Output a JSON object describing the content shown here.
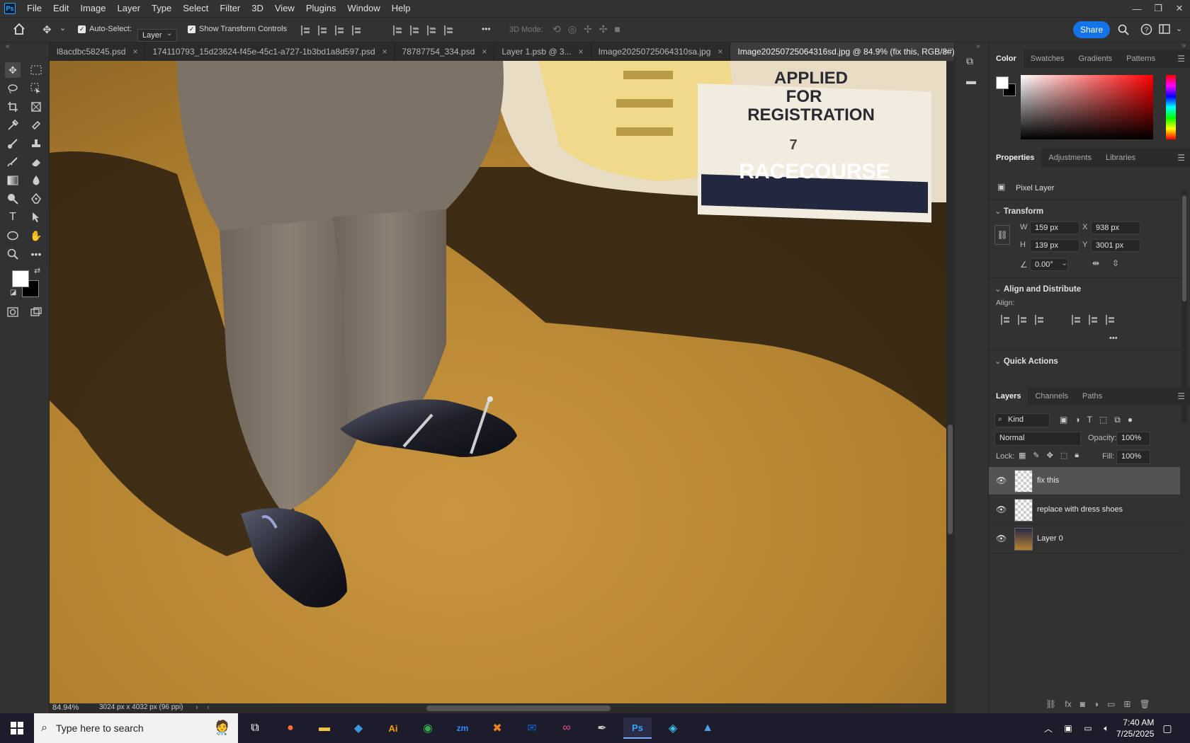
{
  "app": {
    "logo": "Ps",
    "menus": [
      "File",
      "Edit",
      "Image",
      "Layer",
      "Type",
      "Select",
      "Filter",
      "3D",
      "View",
      "Plugins",
      "Window",
      "Help"
    ]
  },
  "options_bar": {
    "auto_select_label": "Auto-Select:",
    "auto_select_value": "Layer",
    "show_transform_label": "Show Transform Controls",
    "more": "•••",
    "mode_3d_label": "3D Mode:",
    "share_label": "Share"
  },
  "tabs": [
    {
      "label": "l8acdbc58245.psd",
      "close": "×"
    },
    {
      "label": "174110793_15d23624-f45e-45c1-a727-1b3bd1a8d597.psd",
      "close": "×"
    },
    {
      "label": "78787754_334.psd",
      "close": "×"
    },
    {
      "label": "Layer 1.psb @ 3...",
      "close": "×"
    },
    {
      "label": "Image20250725064310sa.jpg",
      "close": "×"
    },
    {
      "label": "Image20250725064316sd.jpg @ 84.9% (fix this, RGB/8#) *",
      "close": "×"
    }
  ],
  "canvas_text": {
    "applied": "APPLIED",
    "for": "FOR",
    "registration": "REGISTRATION",
    "racecourse": "RACECOURSE",
    "seven": "7"
  },
  "status": {
    "zoom": "84.94%",
    "doc_info": "3024 px x 4032 px (96 ppi)"
  },
  "color_panel": {
    "tabs": [
      "Color",
      "Swatches",
      "Gradients",
      "Patterns"
    ],
    "active": "Color",
    "foreground": "#ffffff",
    "background": "#000000"
  },
  "properties_panel": {
    "tabs": [
      "Properties",
      "Adjustments",
      "Libraries"
    ],
    "layer_type": "Pixel Layer",
    "transform_title": "Transform",
    "w_label": "W",
    "w": "159 px",
    "h_label": "H",
    "h": "139 px",
    "x_label": "X",
    "x": "938 px",
    "y_label": "Y",
    "y": "3001 px",
    "angle": "0.00°",
    "align_title": "Align and Distribute",
    "align_label": "Align:",
    "more": "•••",
    "quick_actions_title": "Quick Actions"
  },
  "layers_panel": {
    "tabs": [
      "Layers",
      "Channels",
      "Paths"
    ],
    "filter_kind": "Kind",
    "blend_mode": "Normal",
    "opacity_label": "Opacity:",
    "opacity": "100%",
    "lock_label": "Lock:",
    "fill_label": "Fill:",
    "fill": "100%",
    "layers": [
      {
        "name": "fix this",
        "selected": true
      },
      {
        "name": "replace with dress shoes",
        "selected": false
      },
      {
        "name": "Layer 0",
        "selected": false
      }
    ]
  },
  "taskbar": {
    "search_placeholder": "Type here to search",
    "time": "7:40 AM",
    "date": "7/25/2025"
  }
}
